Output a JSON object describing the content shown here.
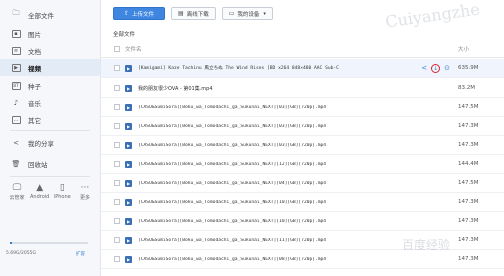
{
  "sidebar": {
    "items": [
      {
        "label": "全部文件",
        "icon": "folder-icon"
      },
      {
        "label": "图片",
        "icon": "image-icon"
      },
      {
        "label": "文档",
        "icon": "document-icon"
      },
      {
        "label": "视频",
        "icon": "video-icon"
      },
      {
        "label": "种子",
        "icon": "torrent-icon"
      },
      {
        "label": "音乐",
        "icon": "music-icon"
      },
      {
        "label": "其它",
        "icon": "more-icon"
      },
      {
        "label": "我的分享",
        "icon": "share-icon"
      },
      {
        "label": "回收站",
        "icon": "trash-icon"
      }
    ],
    "active_index": 3,
    "devices": [
      {
        "label": "云管家",
        "icon": "computer-icon"
      },
      {
        "label": "Android",
        "icon": "android-icon"
      },
      {
        "label": "iPhone",
        "icon": "iphone-icon"
      },
      {
        "label": "更多",
        "icon": "ellipsis-icon"
      }
    ],
    "quota": {
      "text": "5.69G/2055G",
      "link": "扩容",
      "fraction": 0.03
    }
  },
  "toolbar": {
    "upload_label": "上传文件",
    "offline_label": "离线下载",
    "devices_label": "我的设备"
  },
  "breadcrumb": "全部文件",
  "list": {
    "header_name": "文件名",
    "header_size": "大小",
    "rows": [
      {
        "name": "[Kamigami] Kaze Tachinu 風立ちぬ The Wind Rises [BD x264 848×480 AAC Sub-C",
        "size": "635.9M"
      },
      {
        "name": "我的朋友很少OVA - 第01集.mp4",
        "size": "83.2M"
      },
      {
        "name": "[CASO&SumiSora][Boku_wa_Tomodachi_ga_Sukunai_NEXT][03][GB][720p].mp4",
        "size": "147.5M"
      },
      {
        "name": "[CASO&SumiSora][Boku_wa_Tomodachi_ga_Sukunai_NEXT][03][GB][720p].mp4",
        "size": "147.3M"
      },
      {
        "name": "[CASO&SumiSora][Boku_wa_Tomodachi_ga_Sukunai_NEXT][03][GB][720p].mp4",
        "size": "147.3M"
      },
      {
        "name": "[CASO&SumiSora][Boku_wa_Tomodachi_ga_Sukunai_NEXT][12][GB][720p].mp4",
        "size": "144.4M"
      },
      {
        "name": "[CASO&SumiSora][Boku_wa_Tomodachi_ga_Sukunai_NEXT][04][GB][720p].mp4",
        "size": "147.5M"
      },
      {
        "name": "[CASO&SumiSora][Boku_wa_Tomodachi_ga_Sukunai_NEXT][10][GB][720p].mp4",
        "size": "147.3M"
      },
      {
        "name": "[CASO&SumiSora][Boku_wa_Tomodachi_ga_Sukunai_NEXT][10][GB][720p].mp4",
        "size": "147.3M"
      },
      {
        "name": "[CASO&SumiSora][Boku_wa_Tomodachi_ga_Sukunai_NEXT][11][GB][720p].mp4",
        "size": "147.3M"
      },
      {
        "name": "[CASO&SumiSora][Boku_wa_Tomodachi_ga_Sukunai_NEXT][08][GB][720p].mp4",
        "size": "147.3M"
      }
    ]
  },
  "accent_color": "#3f86e0",
  "watermark": {
    "line1": "Cuiyangzhe",
    "line2": "百度经验"
  }
}
